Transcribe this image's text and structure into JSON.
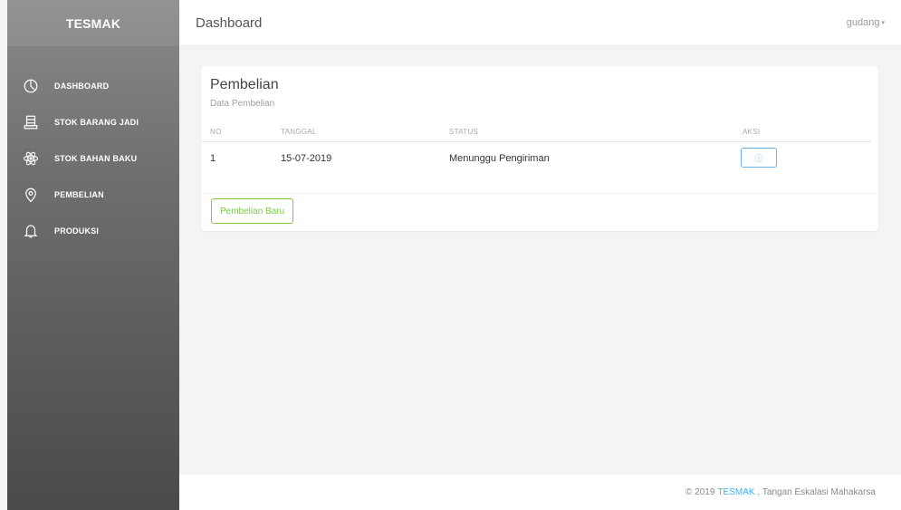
{
  "sidebar": {
    "brand": "TESMAK",
    "items": [
      {
        "label": "DASHBOARD",
        "icon": "pie-chart-icon"
      },
      {
        "label": "STOK BARANG JADI",
        "icon": "storage-icon"
      },
      {
        "label": "STOK BAHAN BAKU",
        "icon": "atom-icon"
      },
      {
        "label": "PEMBELIAN",
        "icon": "location-pin-icon"
      },
      {
        "label": "PRODUKSI",
        "icon": "bell-icon"
      }
    ]
  },
  "header": {
    "title": "Dashboard",
    "user": "gudang"
  },
  "card": {
    "title": "Pembelian",
    "subtitle": "Data Pembelian",
    "columns": [
      "NO",
      "TANGGAL",
      "STATUS",
      "AKSI"
    ],
    "rows": [
      {
        "no": "1",
        "tanggal": "15-07-2019",
        "status": "Menunggu Pengiriman",
        "aksi_icon": "info-icon"
      }
    ],
    "new_button": "Pembelian Baru"
  },
  "footer": {
    "prefix": "© 2019",
    "brand": "TESMAK",
    "suffix": ", Tangan Eskalasi Mahakarsa"
  },
  "colors": {
    "accent_blue": "#3fb0e8",
    "accent_green": "#7ec94a"
  }
}
